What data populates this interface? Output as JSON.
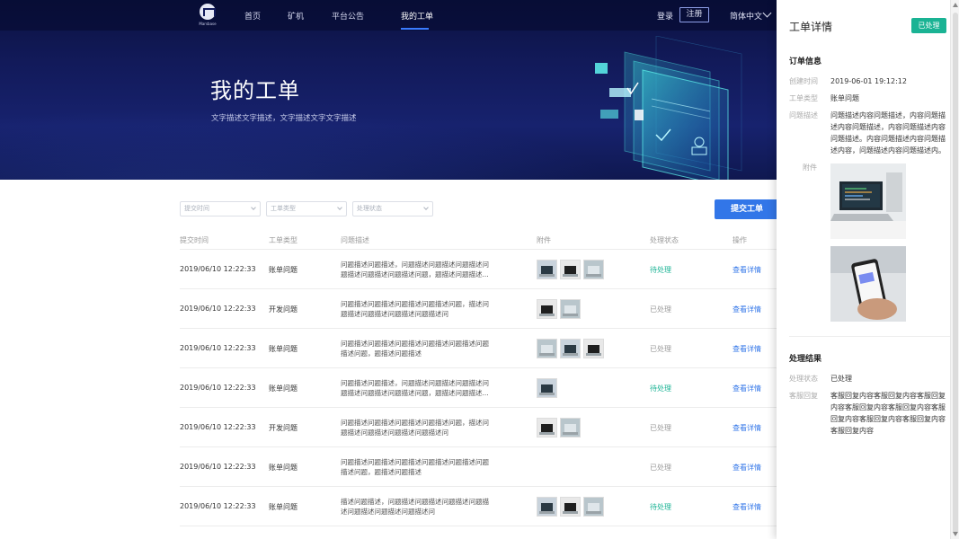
{
  "nav": {
    "logo_text": "Marsbase",
    "items": [
      "首页",
      "矿机",
      "平台公告",
      "我的工单"
    ],
    "active_index": 3,
    "login": "登录",
    "register": "注册",
    "language": "简体中文"
  },
  "hero": {
    "title": "我的工单",
    "subtitle": "文字描述文字描述，文字描述文字文字描述"
  },
  "filters": {
    "submit_time": "提交时间",
    "ticket_type": "工单类型",
    "status": "处理状态",
    "submit_button": "提交工单"
  },
  "table": {
    "headers": [
      "提交时间",
      "工单类型",
      "问题描述",
      "附件",
      "处理状态",
      "操作"
    ],
    "rows": [
      {
        "time": "2019/06/10 12:22:33",
        "type": "账单问题",
        "desc": "问题描述问题描述，问题描述问题描述问题描述问题描述问题描述问题描述问题，题描述问题描述...",
        "attachments": 3,
        "status": "待处理",
        "action": "查看详情"
      },
      {
        "time": "2019/06/10 12:22:33",
        "type": "开发问题",
        "desc": "问题描述问题描述问题描述问题描述问题，描述问题描述问题描述问题描述问题描述问",
        "attachments": 2,
        "status": "已处理",
        "action": "查看详情"
      },
      {
        "time": "2019/06/10 12:22:33",
        "type": "账单问题",
        "desc": "问题描述问题描述问题描述问题描述问题描述问题描述问题，题描述问题描述",
        "attachments": 3,
        "status": "已处理",
        "action": "查看详情"
      },
      {
        "time": "2019/06/10 12:22:33",
        "type": "账单问题",
        "desc": "问题描述问题描述，问题描述问题描述问题描述问题描述问题描述问题描述问题，题描述问题描述...",
        "attachments": 1,
        "status": "待处理",
        "action": "查看详情"
      },
      {
        "time": "2019/06/10 12:22:33",
        "type": "开发问题",
        "desc": "问题描述问题描述问题描述问题描述问题，描述问题描述问题描述问题描述问题描述问",
        "attachments": 2,
        "status": "已处理",
        "action": "查看详情"
      },
      {
        "time": "2019/06/10 12:22:33",
        "type": "账单问题",
        "desc": "问题描述问题描述问题描述问题描述问题描述问题描述问题，题描述问题描述",
        "attachments": 0,
        "status": "已处理",
        "action": "查看详情"
      },
      {
        "time": "2019/06/10 12:22:33",
        "type": "账单问题",
        "desc": "描述问题描述，问题描述问题描述问题描述问题描述问题描述问题描述问题描述问",
        "attachments": 3,
        "status": "待处理",
        "action": "查看详情"
      }
    ]
  },
  "drawer": {
    "title": "工单详情",
    "badge": "已处理",
    "order_section": "订单信息",
    "created_label": "创建时间",
    "created_value": "2019-06-01 19:12:12",
    "type_label": "工单类型",
    "type_value": "账单问题",
    "desc_label": "问题描述",
    "desc_value": "问题描述内容问题描述，内容问题描述内容问题描述，内容问题描述内容问题描述。内容问题描述内容问题描述内容，问题描述内容问题描述内。",
    "attach_label": "附件",
    "result_section": "处理结果",
    "status_label": "处理状态",
    "status_value": "已处理",
    "reply_label": "客服回复",
    "reply_value": "客服回复内容客服回复内容客服回复内容客服回复内容客服回复内容客服回复内容客服回复内容客服回复内容客服回复内容"
  },
  "colors": {
    "accent": "#3276e8",
    "pending": "#1ab394",
    "hero_bg": "#121a5a"
  }
}
